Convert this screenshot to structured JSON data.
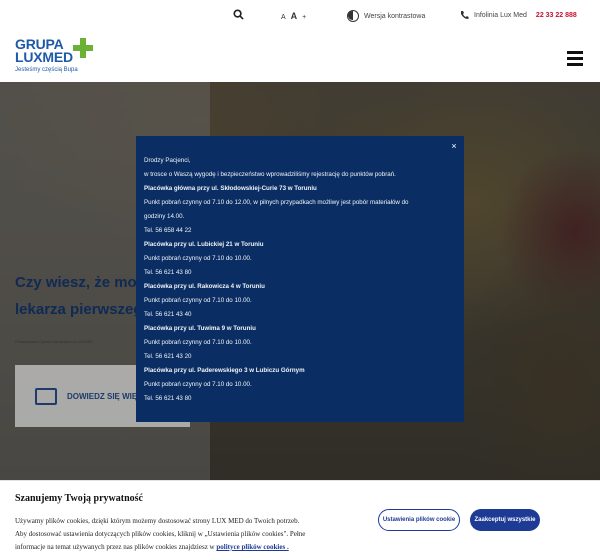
{
  "topbar": {
    "font_small": "A",
    "font_large": "A",
    "font_plus": "+",
    "contrast_label": "Wersja kontrastowa",
    "phone_label": "Infolinia Lux Med",
    "phone_number": "22 33 22 888"
  },
  "header": {
    "logo_line1": "GRUPA",
    "logo_line2": "LUXMED",
    "logo_tagline": "Jesteśmy częścią Bupa"
  },
  "hero": {
    "headline_line1": "Czy wiesz, że możes",
    "headline_line2": "lekarza pierwszego",
    "caption": "Podstawowa Opieka Zdrowotna w LUXMED",
    "cta_label": "DOWIEDZ SIĘ WIĘC"
  },
  "modal": {
    "close_label": "×",
    "lines": [
      {
        "text": "Drodzy Pacjenci,",
        "bold": false
      },
      {
        "text": "w trosce o Waszą wygodę i bezpieczeństwo wprowadziliśmy rejestrację do punktów pobrań.",
        "bold": false
      },
      {
        "text": "Placówka główna przy ul. Skłodowskiej-Curie 73 w Toruniu",
        "bold": true
      },
      {
        "text": "Punkt pobrań czynny od 7.10 do 12.00, w pilnych przypadkach możliwy jest pobór materiałów do",
        "bold": false
      },
      {
        "text": "godziny 14.00.",
        "bold": false
      },
      {
        "text": "Tel. 56 658 44 22",
        "bold": false
      },
      {
        "text": "Placówka przy ul. Lubickiej 21 w Toruniu",
        "bold": true
      },
      {
        "text": "Punkt pobrań czynny od 7.10 do 10.00.",
        "bold": false
      },
      {
        "text": "Tel. 56 621 43 80",
        "bold": false
      },
      {
        "text": "Placówka przy ul. Rakowicza 4 w Toruniu",
        "bold": true
      },
      {
        "text": "Punkt pobrań czynny od 7.10 do 10.00.",
        "bold": false
      },
      {
        "text": "Tel. 56 621 43 40",
        "bold": false
      },
      {
        "text": "Placówka przy ul. Tuwima 9 w Toruniu",
        "bold": true
      },
      {
        "text": "Punkt pobrań czynny od 7.10 do 10.00.",
        "bold": false
      },
      {
        "text": "Tel. 56 621 43 20",
        "bold": false
      },
      {
        "text": "Placówka przy ul. Paderewskiego 3 w Lubiczu Górnym",
        "bold": true
      },
      {
        "text": "Punkt pobrań czynny od 7.10 do 10.00.",
        "bold": false
      },
      {
        "text": "Tel. 56 621 43 80",
        "bold": false
      }
    ]
  },
  "cookie": {
    "title": "Szanujemy Twoją prywatność",
    "line1": "Używamy plików cookies, dzięki którym możemy dostosować strony LUX MED do Twoich potrzeb.",
    "line2": "Aby dostosować ustawienia dotyczących plików cookies, kliknij w „Ustawienia plików cookies\". Pełne",
    "line3_prefix": "informacje na temat używanych przez nas plików cookies znajdziesz w",
    "policy_link": "polityce plików cookies .",
    "settings_button": "Ustawienia plików cookie",
    "accept_button": "Zaakceptuj wszystkie"
  },
  "colors": {
    "brand_blue": "#1d5aa7",
    "brand_green": "#6bb135",
    "modal_bg": "#0a2e63",
    "phone_red": "#c4122f",
    "button_blue": "#1d3b95"
  }
}
